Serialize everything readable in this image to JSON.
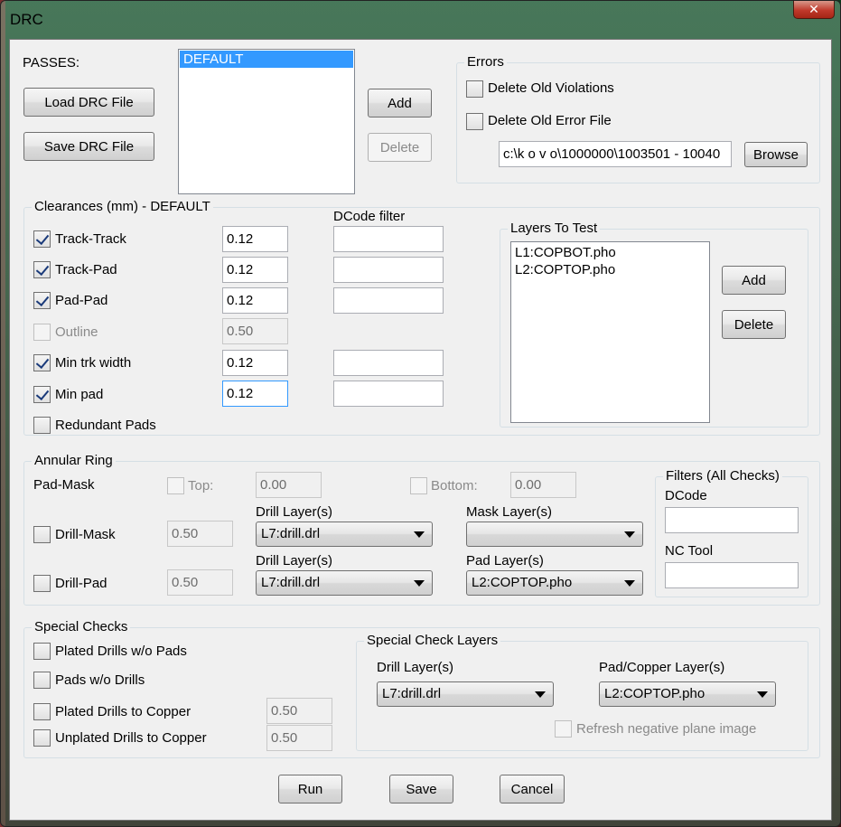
{
  "window": {
    "title": "DRC",
    "close_glyph": "✕"
  },
  "passes": {
    "label": "PASSES:",
    "load_button": "Load DRC File",
    "save_button": "Save DRC File",
    "items": [
      "DEFAULT"
    ],
    "add_button": "Add",
    "delete_button": "Delete"
  },
  "errors": {
    "title": "Errors",
    "delete_old_violations": {
      "label": "Delete Old Violations",
      "checked": false
    },
    "delete_old_error_file": {
      "label": "Delete Old Error File",
      "checked": false
    },
    "path_value": "c:\\k o v o\\1000000\\1003501 - 10040",
    "browse_button": "Browse"
  },
  "clearances": {
    "title": "Clearances (mm) - DEFAULT",
    "dcode_filter_label": "DCode filter",
    "rows": [
      {
        "label": "Track-Track",
        "checked": true,
        "value": "0.12",
        "dcode": ""
      },
      {
        "label": "Track-Pad",
        "checked": true,
        "value": "0.12",
        "dcode": ""
      },
      {
        "label": "Pad-Pad",
        "checked": true,
        "value": "0.12",
        "dcode": ""
      },
      {
        "label": "Outline",
        "checked": false,
        "value": "0.50"
      },
      {
        "label": "Min trk width",
        "checked": true,
        "value": "0.12",
        "dcode": ""
      },
      {
        "label": "Min pad",
        "checked": true,
        "value": "0.12",
        "dcode": ""
      }
    ],
    "redundant_pads": {
      "label": "Redundant Pads",
      "checked": false
    }
  },
  "layers_to_test": {
    "title": "Layers To Test",
    "items": [
      "L1:COPBOT.pho",
      "L2:COPTOP.pho"
    ],
    "add_button": "Add",
    "delete_button": "Delete"
  },
  "annular_ring": {
    "title": "Annular Ring",
    "pad_mask_label": "Pad-Mask",
    "top_label": "Top:",
    "top_value": "0.00",
    "bottom_label": "Bottom:",
    "bottom_value": "0.00",
    "drill_mask": {
      "label": "Drill-Mask",
      "checked": false,
      "value": "0.50",
      "drill_layer_label": "Drill Layer(s)",
      "drill_layer_value": "L7:drill.drl",
      "mask_layer_label": "Mask Layer(s)",
      "mask_layer_value": ""
    },
    "drill_pad": {
      "label": "Drill-Pad",
      "checked": false,
      "value": "0.50",
      "drill_layer_label": "Drill Layer(s)",
      "drill_layer_value": "L7:drill.drl",
      "pad_layer_label": "Pad Layer(s)",
      "pad_layer_value": "L2:COPTOP.pho"
    }
  },
  "filters": {
    "title": "Filters (All Checks)",
    "dcode_label": "DCode",
    "dcode_value": "",
    "nc_tool_label": "NC Tool",
    "nc_tool_value": ""
  },
  "special_checks": {
    "title": "Special Checks",
    "items": [
      {
        "label": "Plated Drills w/o Pads",
        "checked": false
      },
      {
        "label": "Pads w/o Drills",
        "checked": false
      },
      {
        "label": "Plated Drills to Copper",
        "checked": false,
        "value": "0.50"
      },
      {
        "label": "Unplated Drills to Copper",
        "checked": false,
        "value": "0.50"
      }
    ]
  },
  "special_check_layers": {
    "title": "Special Check Layers",
    "drill_layer_label": "Drill Layer(s)",
    "drill_layer_value": "L7:drill.drl",
    "pad_copper_label": "Pad/Copper Layer(s)",
    "pad_copper_value": "L2:COPTOP.pho",
    "refresh_label": "Refresh negative plane image",
    "refresh_checked": false
  },
  "footer": {
    "run_button": "Run",
    "save_button": "Save",
    "cancel_button": "Cancel"
  }
}
